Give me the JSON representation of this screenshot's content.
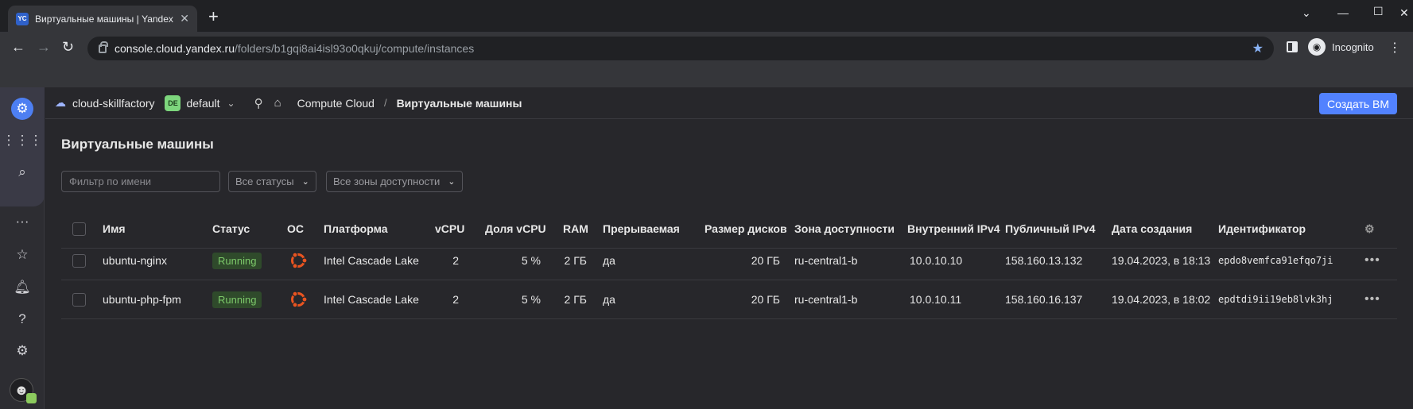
{
  "browser": {
    "tab_title": "Виртуальные машины | Yandex Cloud",
    "favicon": "YC",
    "url_host": "console.cloud.yandex.ru",
    "url_path": "/folders/b1gqi8ai4isl93o0qkuj/compute/instances",
    "incognito_label": "Incognito"
  },
  "header": {
    "cloud_name": "cloud-skillfactory",
    "folder_badge": "DE",
    "folder_name": "default",
    "crumb_service": "Compute Cloud",
    "crumb_separator": "/",
    "crumb_current": "Виртуальные машины",
    "create_button": "Создать ВМ"
  },
  "page": {
    "title": "Виртуальные машины",
    "filter_placeholder": "Фильтр по имени",
    "status_select": "Все статусы",
    "zone_select": "Все зоны доступности"
  },
  "table": {
    "columns": [
      "Имя",
      "Статус",
      "ОС",
      "Платформа",
      "vCPU",
      "Доля vCPU",
      "RAM",
      "Прерываемая",
      "Размер дисков",
      "Зона доступности",
      "Внутренний IPv4",
      "Публичный IPv4",
      "Дата создания",
      "Идентификатор"
    ],
    "rows": [
      {
        "name": "ubuntu-nginx",
        "status": "Running",
        "os_icon": "ubuntu-icon",
        "platform": "Intel Cascade Lake",
        "vcpu": "2",
        "vcpu_share": "5 %",
        "ram": "2 ГБ",
        "preemptible": "да",
        "disk_size": "20 ГБ",
        "zone": "ru-central1-b",
        "internal_ip": "10.0.10.10",
        "public_ip": "158.160.13.132",
        "created": "19.04.2023, в 18:13",
        "id": "epdo8vemfca91efqo7ji"
      },
      {
        "name": "ubuntu-php-fpm",
        "status": "Running",
        "os_icon": "ubuntu-icon",
        "platform": "Intel Cascade Lake",
        "vcpu": "2",
        "vcpu_share": "5 %",
        "ram": "2 ГБ",
        "preemptible": "да",
        "disk_size": "20 ГБ",
        "zone": "ru-central1-b",
        "internal_ip": "10.0.10.11",
        "public_ip": "158.160.16.137",
        "created": "19.04.2023, в 18:02",
        "id": "epdtdi9ii19eb8lvk3hj"
      }
    ]
  },
  "colors": {
    "accent": "#5282ff",
    "running_text": "#7dc96a",
    "ubuntu": "#e95420"
  }
}
